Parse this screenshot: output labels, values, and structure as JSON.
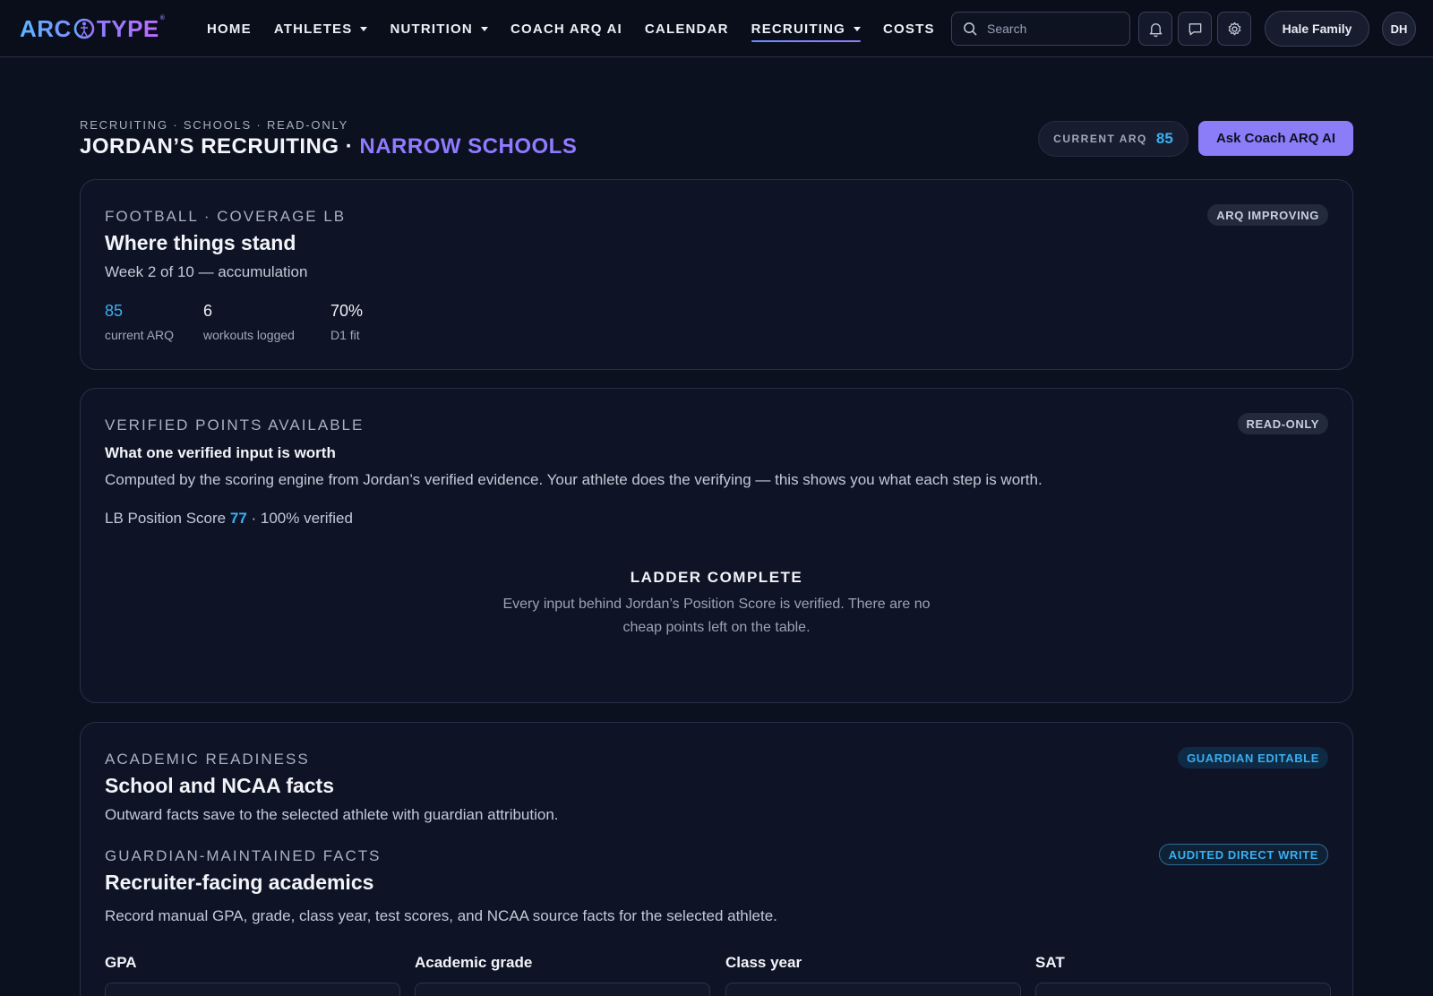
{
  "brand": {
    "name": "ARCTYPE",
    "pre": "ARC",
    "post": "TYPE",
    "mark": "arq-figure-icon",
    "registered": "®"
  },
  "nav": {
    "links": [
      {
        "label": "HOME",
        "dropdown": false,
        "active": false
      },
      {
        "label": "ATHLETES",
        "dropdown": true,
        "active": false
      },
      {
        "label": "NUTRITION",
        "dropdown": true,
        "active": false
      },
      {
        "label": "COACH ARQ AI",
        "dropdown": false,
        "active": false
      },
      {
        "label": "CALENDAR",
        "dropdown": false,
        "active": false
      },
      {
        "label": "RECRUITING",
        "dropdown": true,
        "active": true
      },
      {
        "label": "COSTS",
        "dropdown": false,
        "active": false
      }
    ],
    "search_placeholder": "Search",
    "family_label": "Hale Family",
    "avatar_initials": "DH"
  },
  "header": {
    "breadcrumb": "RECRUITING · SCHOOLS · READ-ONLY",
    "title_main": "JORDAN’S RECRUITING · ",
    "title_accent": "NARROW SCHOOLS",
    "arq_label": "CURRENT ARQ",
    "arq_value": "85",
    "ask_button": "Ask Coach ARQ AI"
  },
  "status_card": {
    "eyebrow": "FOOTBALL · COVERAGE LB",
    "badge": "ARQ IMPROVING",
    "title": "Where things stand",
    "subtitle": "Week 2 of 10 — accumulation",
    "stats": [
      {
        "value": "85",
        "caption": "current ARQ"
      },
      {
        "value": "6",
        "caption": "workouts logged"
      },
      {
        "value": "70%",
        "caption": "D1 fit"
      }
    ]
  },
  "verified_card": {
    "eyebrow": "VERIFIED POINTS AVAILABLE",
    "badge": "READ-ONLY",
    "title": "What one verified input is worth",
    "body": "Computed by the scoring engine from Jordan’s verified evidence. Your athlete does the verifying — this shows you what each step is worth.",
    "score_prefix": "LB Position Score ",
    "score_value": "77",
    "score_suffix": " · 100% verified",
    "ladder_title": "LADDER COMPLETE",
    "ladder_desc": "Every input behind Jordan’s Position Score is verified. There are no cheap points left on the table."
  },
  "academic_card": {
    "eyebrow": "ACADEMIC READINESS",
    "badge": "GUARDIAN EDITABLE",
    "title": "School and NCAA facts",
    "subtitle": "Outward facts save to the selected athlete with guardian attribution.",
    "section_eyebrow": "GUARDIAN-MAINTAINED FACTS",
    "section_badge": "AUDITED DIRECT WRITE",
    "section_title": "Recruiter-facing academics",
    "section_desc": "Record manual GPA, grade, class year, test scores, and NCAA source facts for the selected athlete.",
    "fields": [
      {
        "label": "GPA",
        "value": ""
      },
      {
        "label": "Academic grade",
        "value": ""
      },
      {
        "label": "Class year",
        "value": ""
      },
      {
        "label": "SAT",
        "value": ""
      }
    ]
  },
  "colors": {
    "accent_purple": "#8f7bff",
    "accent_blue": "#3aaef0",
    "button": "#8b7cf8",
    "background": "#0c1120"
  }
}
